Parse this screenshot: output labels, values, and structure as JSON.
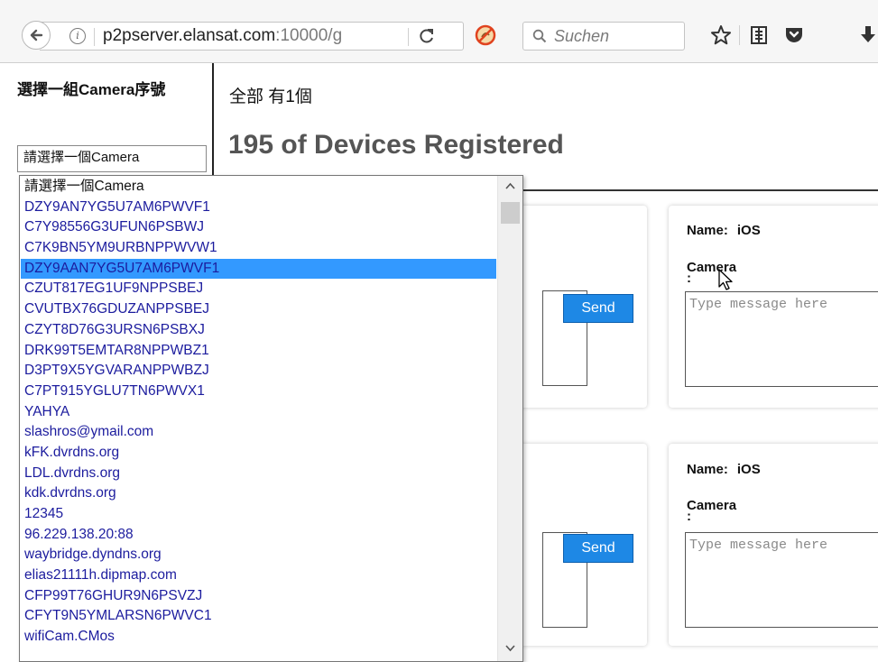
{
  "browser": {
    "url_host": "p2pserver.elansat.com",
    "url_rest": ":10000/g",
    "search_placeholder": "Suchen"
  },
  "sidebar": {
    "title": "選擇一組Camera序號",
    "select_value": "請選擇一個Camera"
  },
  "main": {
    "count_text": "全部 有1個",
    "heading": "195 of Devices Registered"
  },
  "cards": [
    {
      "name_label": "Name:",
      "name_value": "iOS",
      "camera_label": "Camera",
      "colon": ":",
      "message_placeholder": "Type message here",
      "send_label": "Send"
    },
    {
      "name_label": "Name:",
      "name_value": "iOS",
      "camera_label": "Camera",
      "colon": ":",
      "message_placeholder": "Type message here",
      "send_label": "Send"
    }
  ],
  "dropdown": {
    "highlighted_index": 4,
    "options": [
      "請選擇一個Camera",
      "DZY9AN7YG5U7AM6PWVF1",
      "C7Y98556G3UFUN6PSBWJ",
      "C7K9BN5YM9URBNPPWVW1",
      "DZY9AAN7YG5U7AM6PWVF1",
      "CZUT817EG1UF9NPPSBEJ",
      "CVUTBX76GDUZANPPSBEJ",
      "CZYT8D76G3URSN6PSBXJ",
      "DRK99T5EMTAR8NPPWBZ1",
      "D3PT9X5YGVARANPPWBZJ",
      "C7PT915YGLU7TN6PWVX1",
      "YAHYA",
      "slashros@ymail.com",
      "kFK.dvrdns.org",
      "LDL.dvrdns.org",
      "kdk.dvrdns.org",
      "12345",
      "96.229.138.20:88",
      "waybridge.dyndns.org",
      "elias21111h.dipmap.com",
      "CFP99T76GHUR9N6PSVZJ",
      "CFYT9N5YMLARSN6PWVC1",
      "wifiCam.CMos"
    ]
  }
}
